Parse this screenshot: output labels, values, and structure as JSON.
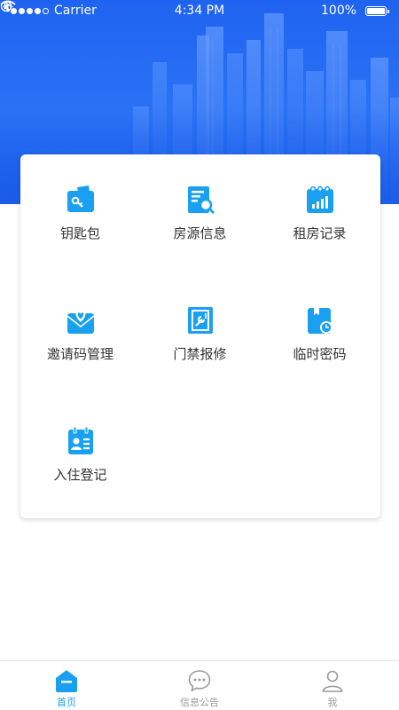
{
  "status_bar": {
    "carrier": "Carrier",
    "time": "4:34 PM",
    "battery": "100%"
  },
  "colors": {
    "accent": "#1aa0f0",
    "banner": "#2a72f5",
    "inactive_tab": "#9a9a9a"
  },
  "menu": [
    {
      "label": "钥匙包",
      "icon": "wallet-icon"
    },
    {
      "label": "房源信息",
      "icon": "property-search-icon"
    },
    {
      "label": "租房记录",
      "icon": "rental-record-icon"
    },
    {
      "label": "邀请码管理",
      "icon": "invite-code-icon"
    },
    {
      "label": "门禁报修",
      "icon": "access-repair-icon"
    },
    {
      "label": "临时密码",
      "icon": "temp-password-icon"
    },
    {
      "label": "入住登记",
      "icon": "checkin-register-icon"
    }
  ],
  "tabs": [
    {
      "label": "首页",
      "icon": "home-icon",
      "active": true
    },
    {
      "label": "信息公告",
      "icon": "chat-bubble-icon",
      "active": false
    },
    {
      "label": "我",
      "icon": "person-icon",
      "active": false
    }
  ]
}
